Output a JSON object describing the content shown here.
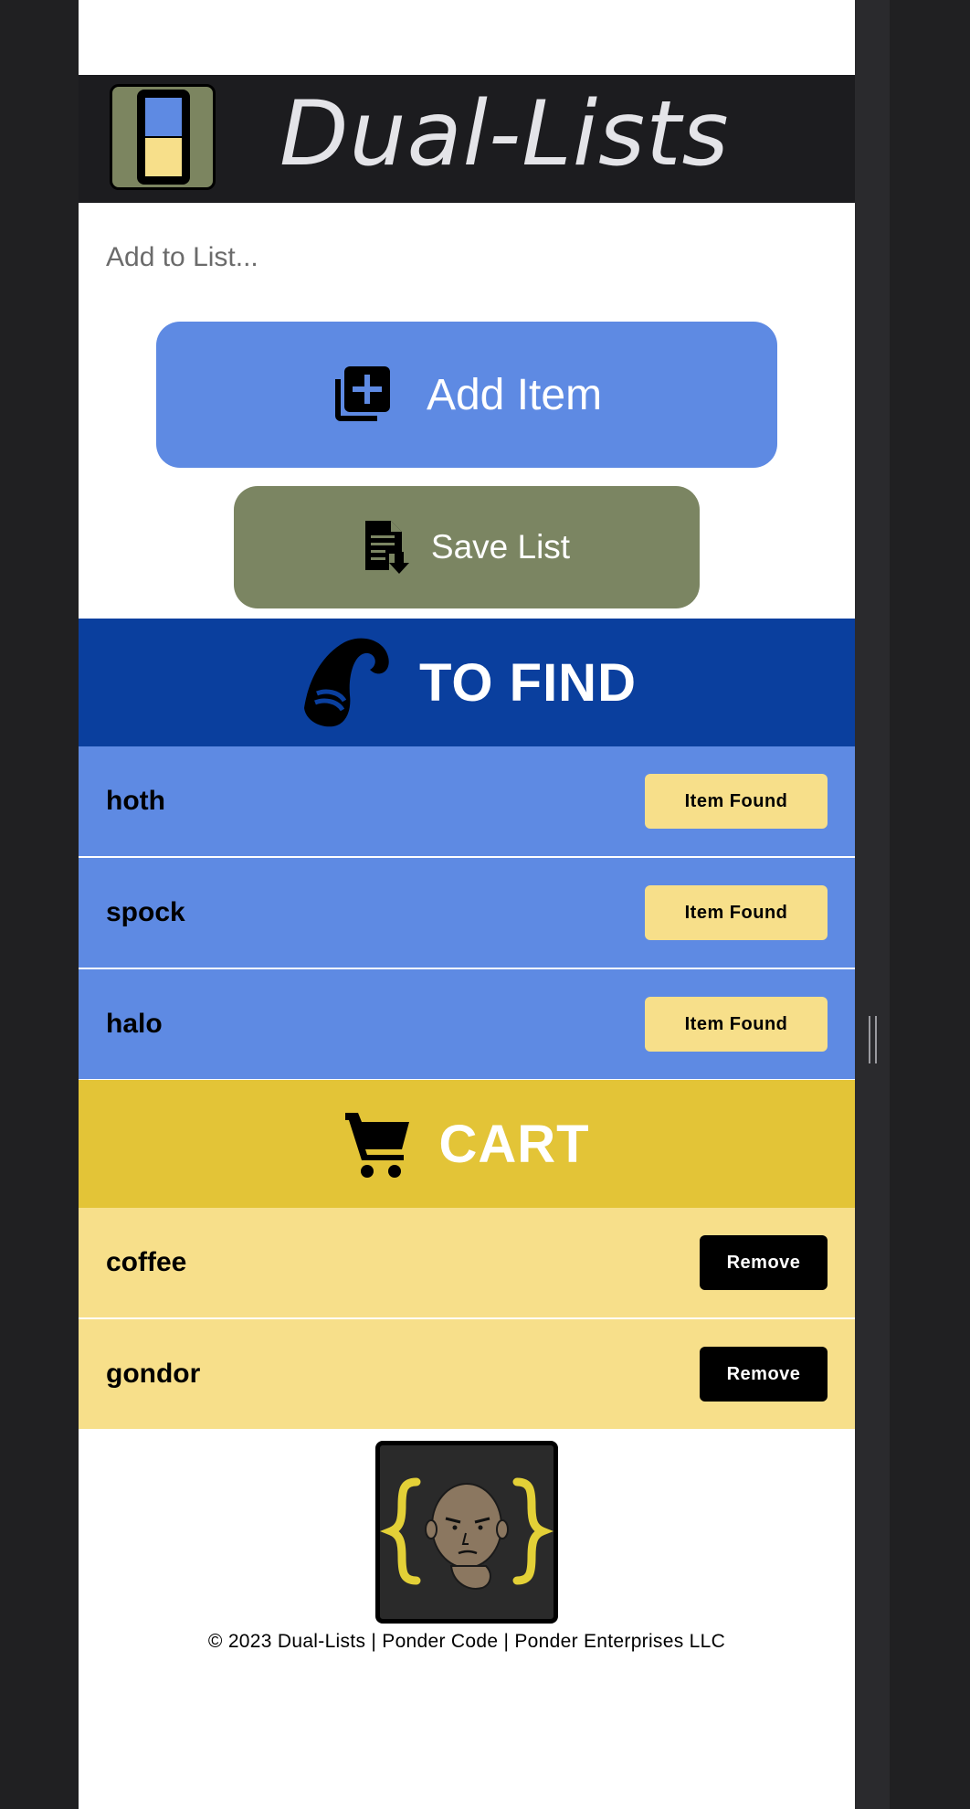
{
  "app": {
    "title": "Dual-Lists"
  },
  "input": {
    "placeholder": "Add to List..."
  },
  "buttons": {
    "add_item": "Add Item",
    "save_list": "Save List"
  },
  "to_find": {
    "heading": "TO FIND",
    "items": [
      {
        "name": "hoth",
        "action": "Item Found"
      },
      {
        "name": "spock",
        "action": "Item Found"
      },
      {
        "name": "halo",
        "action": "Item Found"
      }
    ]
  },
  "cart": {
    "heading": "CART",
    "items": [
      {
        "name": "coffee",
        "action": "Remove"
      },
      {
        "name": "gondor",
        "action": "Remove"
      }
    ]
  },
  "footer": {
    "text": "© 2023 Dual-Lists | Ponder Code | Ponder Enterprises LLC"
  },
  "colors": {
    "header_bg": "#1c1c1f",
    "blue": "#5e8ae3",
    "dark_blue": "#0a3f9e",
    "olive": "#7b8562",
    "yellow": "#e3c437",
    "light_yellow": "#f7df8a"
  },
  "icons": {
    "logo": "dual-lists-logo-icon",
    "add": "add-to-queue-icon",
    "save": "document-download-icon",
    "find": "wizard-hat-icon",
    "cart": "shopping-cart-icon",
    "footer": "ponder-code-logo-icon"
  }
}
